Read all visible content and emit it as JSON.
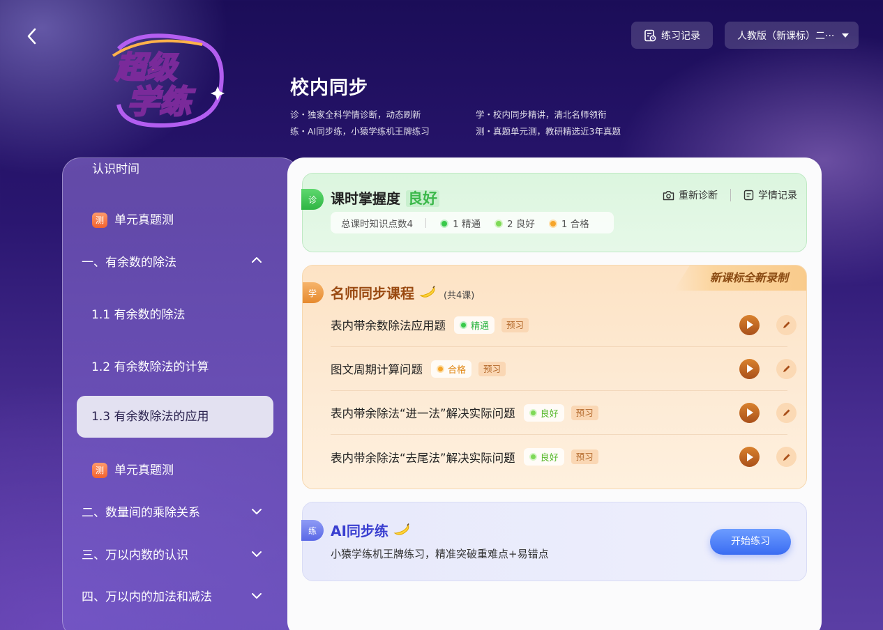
{
  "header": {
    "logo_text_1": "超级",
    "logo_text_2": "学练",
    "title": "校内同步",
    "features": [
      "诊・独家全科学情诊断，动态刷新",
      "学・校内同步精讲，清北名师领衔",
      "练・AI同步练，小猿学练机王牌练习",
      "测・真题单元测，教研精选近3年真题"
    ],
    "record_label": "练习记录",
    "edition_label": "人教版（新课标）二···"
  },
  "sidebar": {
    "items": [
      {
        "type": "lesson",
        "label": "认识时间"
      },
      {
        "type": "test",
        "badge": "测",
        "label": "单元真题测"
      },
      {
        "type": "chapter",
        "label": "一、有余数的除法",
        "expanded": true
      },
      {
        "type": "lesson",
        "label": "1.1 有余数的除法"
      },
      {
        "type": "lesson",
        "label": "1.2 有余数除法的计算"
      },
      {
        "type": "lesson",
        "label": "1.3 有余数除法的应用",
        "active": true
      },
      {
        "type": "test",
        "badge": "测",
        "label": "单元真题测"
      },
      {
        "type": "chapter",
        "label": "二、数量间的乘除关系",
        "expanded": false
      },
      {
        "type": "chapter",
        "label": "三、万以内数的认识",
        "expanded": false
      },
      {
        "type": "chapter",
        "label": "四、万以内的加法和减法",
        "expanded": false
      }
    ]
  },
  "diagnosis": {
    "tag": "诊",
    "title": "课时掌握度",
    "level": "良好",
    "total_label": "总课时知识点数4",
    "stats": [
      "1 精通",
      "2 良好",
      "1 合格"
    ],
    "rediagnose_label": "重新诊断",
    "history_label": "学情记录"
  },
  "course": {
    "tag": "学",
    "title": "名师同步课程",
    "count": "(共4课)",
    "ribbon": "新课标全新录制",
    "lessons": [
      {
        "title": "表内带余数除法应用题",
        "status": "精通",
        "status_color": "#2fb544",
        "tag": "预习"
      },
      {
        "title": "图文周期计算问题",
        "status": "合格",
        "status_color": "#e08612",
        "tag": "预习"
      },
      {
        "title": "表内带余除法“进一法”解决实际问题",
        "status": "良好",
        "status_color": "#58b92d",
        "tag": "预习"
      },
      {
        "title": "表内带余除法“去尾法”解决实际问题",
        "status": "良好",
        "status_color": "#58b92d",
        "tag": "预习"
      }
    ]
  },
  "ai": {
    "tag": "练",
    "title": "AI同步练",
    "subtitle": "小猿学练机王牌练习，精准突破重难点+易错点",
    "start_label": "开始练习"
  }
}
